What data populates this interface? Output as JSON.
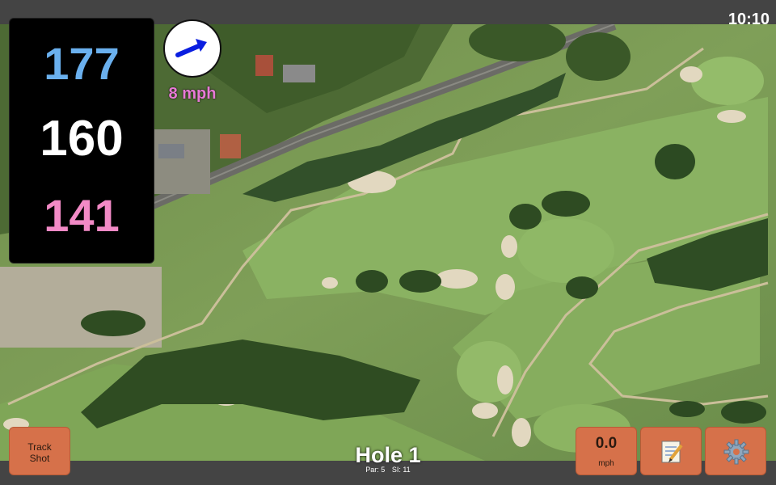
{
  "status": {
    "time": "10:10"
  },
  "distances": {
    "back": "177",
    "middle": "160",
    "front": "141"
  },
  "wind": {
    "speed_label": "8 mph",
    "direction_icon": "arrow-icon"
  },
  "buttons": {
    "track_shot": {
      "line1": "Track",
      "line2": "Shot"
    },
    "wind_input": {
      "value": "0.0",
      "unit": "mph"
    },
    "notes": {
      "icon": "notepad-icon"
    },
    "settings": {
      "icon": "gear-icon"
    }
  },
  "hole": {
    "title": "Hole 1",
    "par_label": "Par: 5",
    "si_label": "SI: 11"
  },
  "colors": {
    "back": "#6ab0ee",
    "middle": "#ffffff",
    "front": "#f28ac6",
    "wind_text": "#e879d6",
    "button": "#d6714a",
    "arrow": "#0a1ee0"
  }
}
